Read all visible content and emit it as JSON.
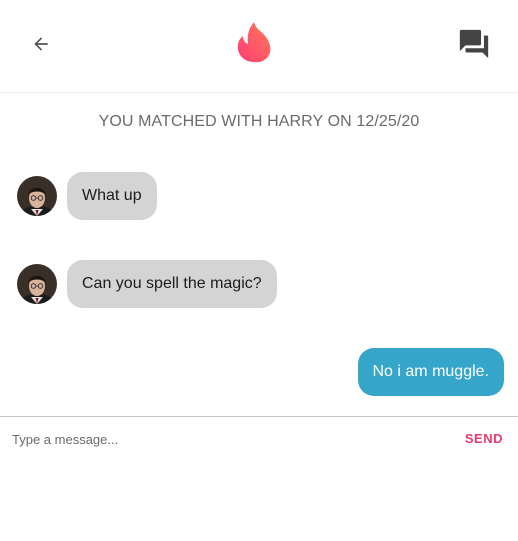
{
  "header": {
    "back_icon": "arrow-left-icon",
    "logo_icon": "flame-logo-icon",
    "messages_icon": "forum-icon"
  },
  "match_banner": "YOU MATCHED WITH HARRY ON 12/25/20",
  "messages": [
    {
      "from": "Harry",
      "direction": "incoming",
      "text": "What up"
    },
    {
      "from": "Harry",
      "direction": "incoming",
      "text": "Can you spell the magic?"
    },
    {
      "from": "me",
      "direction": "outgoing",
      "text": "No i am muggle."
    }
  ],
  "composer": {
    "placeholder": "Type a message...",
    "value": "",
    "send_label": "SEND"
  },
  "colors": {
    "incoming_bubble": "#d4d4d4",
    "outgoing_bubble": "#35a5c9",
    "send_accent": "#ea3a6f",
    "logo_gradient_start": "#fd5b75",
    "logo_gradient_end": "#ff8a5c"
  }
}
